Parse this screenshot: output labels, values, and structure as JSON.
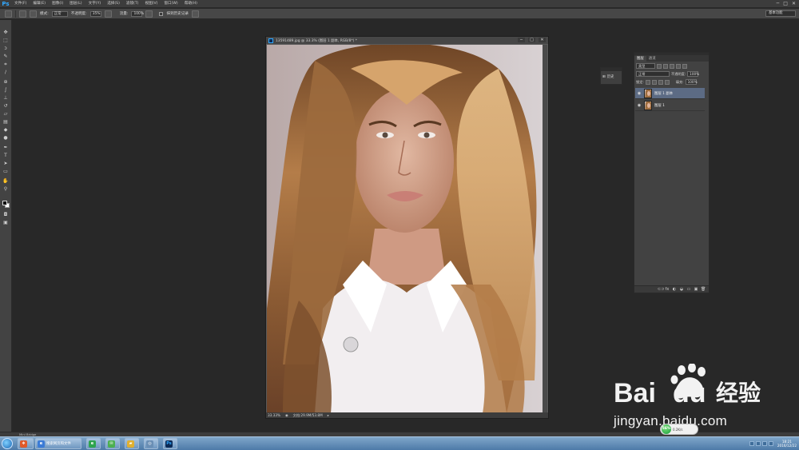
{
  "app": {
    "logo": "Ps",
    "menus": [
      "文件(F)",
      "编辑(E)",
      "图像(I)",
      "图层(L)",
      "文字(Y)",
      "选择(S)",
      "滤镜(T)",
      "视图(V)",
      "窗口(W)",
      "帮助(H)"
    ],
    "window_controls": [
      "─",
      "□",
      "✕"
    ]
  },
  "options_bar": {
    "mode_label": "模式:",
    "mode_value": "正常",
    "opacity_label": "不透明度:",
    "opacity_value": "35%",
    "flow_label": "流量:",
    "flow_value": "100%",
    "erase_history_label": "抹到历史记录",
    "workspace": "基本功能"
  },
  "document": {
    "title": "13591489.jpg @ 33.3% (图层 1 副本, RGB/8*) *",
    "zoom": "33.33%",
    "doc_size": "文档:29.9M/53.8M",
    "controls": [
      "─",
      "□",
      "✕"
    ]
  },
  "history_panel": {
    "button_label": "历史"
  },
  "layers_panel": {
    "tabs": [
      "图层",
      "通道"
    ],
    "filter_kind": "类型",
    "blend_mode": "正常",
    "opacity_label": "不透明度:",
    "opacity_value": "100%",
    "lock_label": "锁定:",
    "fill_label": "填充:",
    "fill_value": "100%",
    "layers": [
      {
        "name": "图层 1 副本",
        "selected": true
      },
      {
        "name": "图层 1",
        "selected": false
      }
    ],
    "bottom_icons": [
      "⊂⊃",
      "fx",
      "◐",
      "◒",
      "▭",
      "▣",
      "🗑"
    ]
  },
  "mini_bar": {
    "label": "Mini Bridge"
  },
  "taskbar": {
    "items": [
      {
        "label": "搜索网页和文件",
        "color": "#3b7bd6"
      },
      {
        "label": "",
        "color": "#2ea44f"
      },
      {
        "label": "",
        "color": "#4caf50"
      },
      {
        "label": "",
        "color": "#e0b030"
      },
      {
        "label": "",
        "color": "#6a8fb5"
      },
      {
        "label": "Ps",
        "color": "#0b2a55"
      }
    ],
    "clock_time": "18:21",
    "clock_date": "2016/12/22"
  },
  "widget": {
    "ball_text": "56%",
    "text": "0.2K/s"
  },
  "watermark": {
    "site": "jingyan.baidu.com"
  }
}
